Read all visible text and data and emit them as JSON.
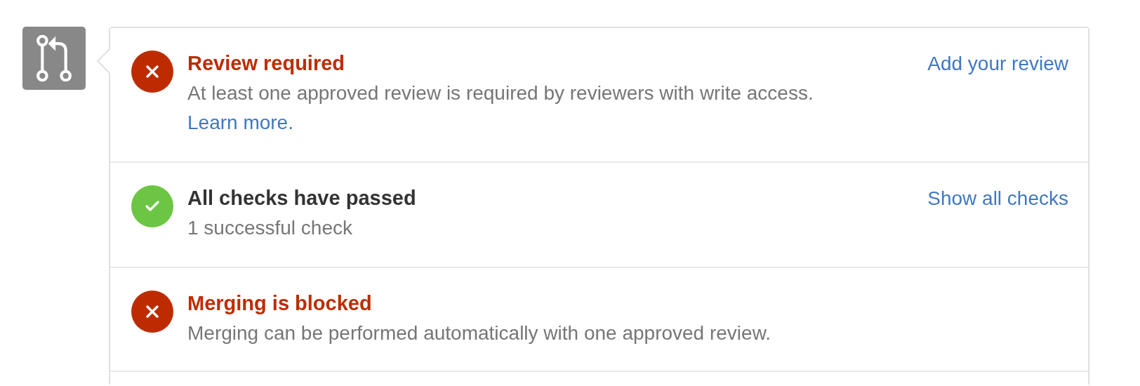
{
  "sections": [
    {
      "kind": "failure",
      "title": "Review required",
      "description": "At least one approved review is required by reviewers with write access.",
      "link": "Learn more.",
      "action": "Add your review"
    },
    {
      "kind": "success",
      "title": "All checks have passed",
      "description": "1 successful check",
      "action": "Show all checks"
    },
    {
      "kind": "failure",
      "title": "Merging is blocked",
      "description": "Merging can be performed automatically with one approved review."
    }
  ]
}
